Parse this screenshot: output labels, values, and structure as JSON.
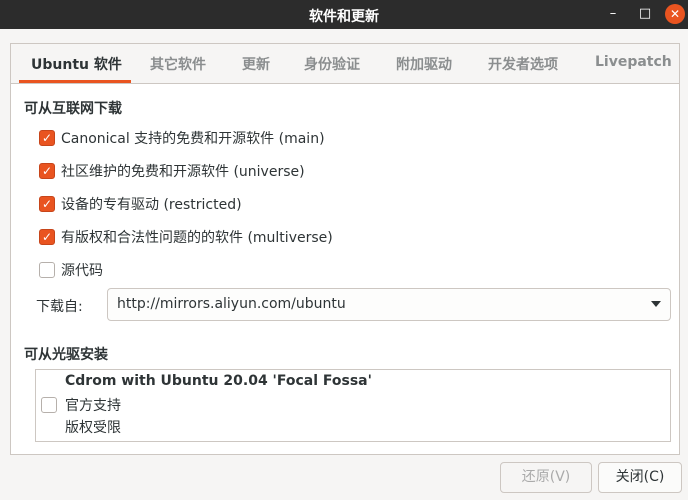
{
  "window": {
    "title": "软件和更新"
  },
  "tabs": [
    {
      "label": "Ubuntu 软件"
    },
    {
      "label": "其它软件"
    },
    {
      "label": "更新"
    },
    {
      "label": "身份验证"
    },
    {
      "label": "附加驱动"
    },
    {
      "label": "开发者选项"
    },
    {
      "label": "Livepatch"
    }
  ],
  "internet": {
    "title": "可从互联网下载",
    "items": [
      {
        "label": "Canonical 支持的免费和开源软件 (main)",
        "checked": true
      },
      {
        "label": "社区维护的免费和开源软件 (universe)",
        "checked": true
      },
      {
        "label": "设备的专有驱动 (restricted)",
        "checked": true
      },
      {
        "label": "有版权和合法性问题的的软件 (multiverse)",
        "checked": true
      },
      {
        "label": "源代码",
        "checked": false
      }
    ],
    "download_label": "下载自:",
    "download_value": "http://mirrors.aliyun.com/ubuntu"
  },
  "cdrom": {
    "title": "可从光驱安装",
    "name": "Cdrom with Ubuntu 20.04 'Focal Fossa'",
    "line2": "官方支持",
    "line3": "版权受限",
    "checked": false
  },
  "buttons": {
    "revert": "还原(V)",
    "close": "关闭(C)"
  },
  "colors": {
    "accent": "#e95420",
    "titlebar": "#2c2c2c"
  }
}
